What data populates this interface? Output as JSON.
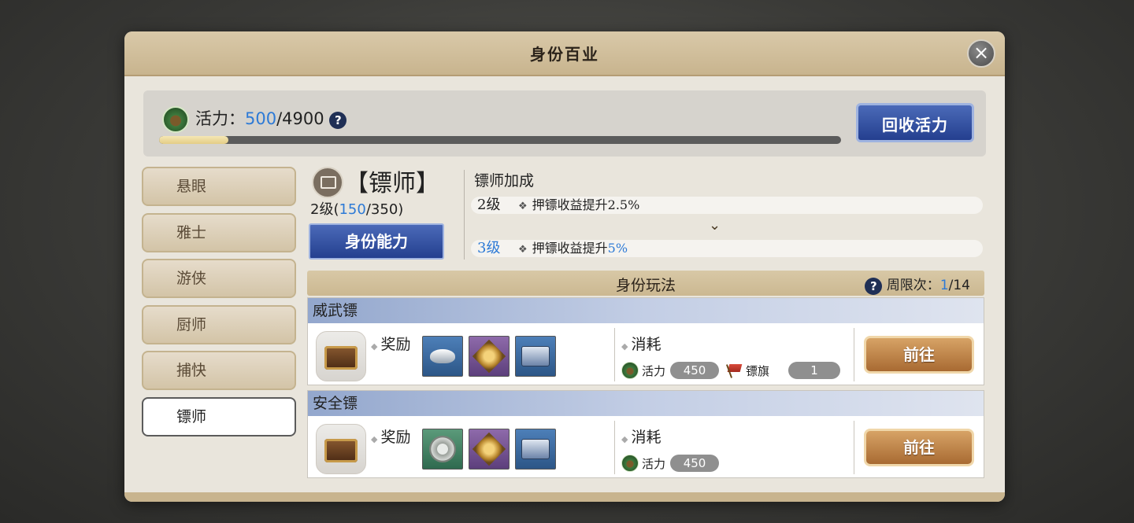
{
  "title": "身份百业",
  "vigor": {
    "label": "活力：",
    "current": "500",
    "sep": "/",
    "max": "4900",
    "progress": 0.102,
    "reclaim_label": "回收活力"
  },
  "sidebar": {
    "items": [
      {
        "label": "悬眼"
      },
      {
        "label": "雅士"
      },
      {
        "label": "游侠"
      },
      {
        "label": "厨师"
      },
      {
        "label": "捕快"
      },
      {
        "label": "镖师",
        "active": true
      }
    ]
  },
  "identity": {
    "name": "【镖师】",
    "level_prefix": "2级(",
    "exp": "150",
    "exp_max": "/350)",
    "ability_label": "身份能力",
    "bonus_title": "镖师加成",
    "bonus_current_level": "2级",
    "bonus_current_text": "押镖收益提升2.5%",
    "bonus_next_level": "3级",
    "bonus_next_text_prefix": "押镖收益提升",
    "bonus_next_value": "5%"
  },
  "gameplay": {
    "title": "身份玩法",
    "limit_label": "周限次：",
    "limit_current": "1",
    "limit_max": "/14"
  },
  "escorts": [
    {
      "name": "威武镖",
      "reward_label": "奖励",
      "cost_label": "消耗",
      "vigor_label": "活力",
      "vigor_cost": "450",
      "flag_label": "镖旗",
      "flag_cost": "1",
      "goto_label": "前往",
      "items": [
        "silver-ingot-icon",
        "medal-icon",
        "chest-icon"
      ]
    },
    {
      "name": "安全镖",
      "reward_label": "奖励",
      "cost_label": "消耗",
      "vigor_label": "活力",
      "vigor_cost": "450",
      "goto_label": "前往",
      "items": [
        "coin-icon",
        "medal-icon",
        "chest-icon"
      ]
    }
  ],
  "colors": {
    "accent_blue": "#2d7ad6",
    "button_blue": "#243f8f",
    "button_gold": "#a86a32",
    "title_bar": "#c8b48e"
  }
}
